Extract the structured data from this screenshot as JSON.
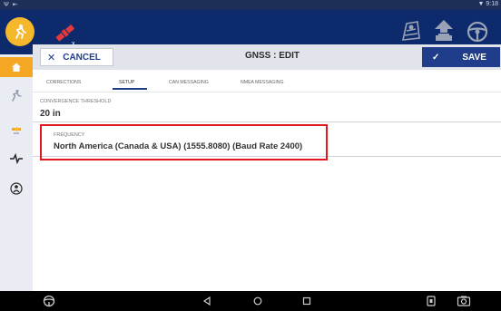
{
  "status_bar": {
    "left_indicators": "Ψ ⇤",
    "time": "▼ 9:18"
  },
  "app_bar": {
    "icons": [
      "logo-icon",
      "satellite-icon",
      "implement-icon",
      "vehicle-icon",
      "steering-icon"
    ]
  },
  "left_nav": {
    "items": [
      "home-icon",
      "guidance-icon",
      "gnss-icon",
      "signal-icon",
      "operator-icon"
    ],
    "active": "home-icon"
  },
  "toolbar": {
    "cancel_label": "CANCEL",
    "title": "GNSS : EDIT",
    "save_label": "SAVE"
  },
  "tabs": [
    {
      "label": "CORRECTIONS"
    },
    {
      "label": "SETUP"
    },
    {
      "label": "CAN MESSAGING"
    },
    {
      "label": "NMEA MESSAGING"
    }
  ],
  "active_tab": "SETUP",
  "fields": {
    "convergence_threshold": {
      "label": "CONVERGENCE THRESHOLD",
      "value": "20 in"
    },
    "frequency": {
      "label": "FREQUENCY",
      "value": "North America (Canada & USA) (1555.8080) (Baud Rate 2400)"
    }
  },
  "colors": {
    "app_bar": "#0d2a6c",
    "accent": "#f5a623",
    "save_button": "#1f3d8a",
    "highlight": "#e0171f"
  },
  "bottom_nav": {
    "icons": [
      "steering-wheel-icon",
      "back-icon",
      "home-circle-icon",
      "recents-icon",
      "screenshot-icon",
      "camera-icon"
    ]
  }
}
